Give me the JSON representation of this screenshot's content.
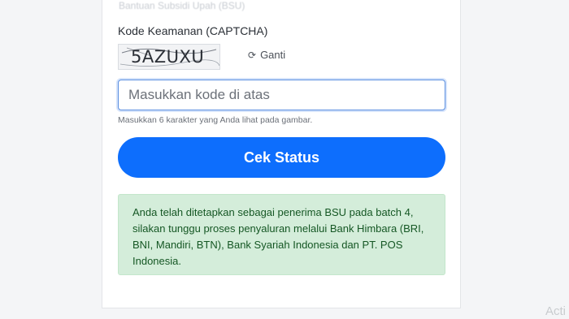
{
  "form": {
    "faded_heading": "Bantuan Subsidi Upah (BSU)",
    "captcha_label": "Kode Keamanan (CAPTCHA)",
    "captcha_code": "5AZUXU",
    "refresh_icon": "refresh-icon",
    "refresh_label": "Ganti",
    "input_placeholder": "Masukkan kode di atas",
    "input_value": "",
    "hint": "Masukkan 6 karakter yang Anda lihat pada gambar.",
    "submit_label": "Cek Status"
  },
  "result": {
    "message": "Anda telah ditetapkan sebagai penerima BSU pada batch 4, silakan tunggu proses penyaluran melalui Bank Himbara (BRI, BNI, Mandiri, BTN), Bank Syariah Indonesia dan PT. POS Indonesia."
  },
  "watermark": "Acti",
  "colors": {
    "primary": "#0d6efd",
    "success_bg": "#d4edda",
    "success_text": "#155724"
  }
}
